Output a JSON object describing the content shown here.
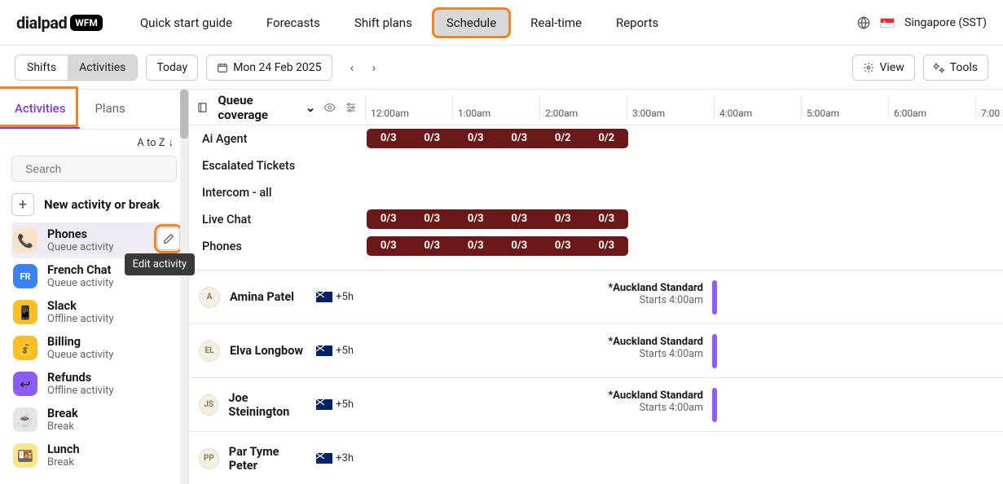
{
  "header": {
    "logo_text": "dialpad",
    "logo_badge": "WFM",
    "nav": [
      "Quick start guide",
      "Forecasts",
      "Shift plans",
      "Schedule",
      "Real-time",
      "Reports"
    ],
    "active_nav_index": 3,
    "region": "Singapore (SST)"
  },
  "subheader": {
    "toggle": [
      "Shifts",
      "Activities"
    ],
    "toggle_active_index": 1,
    "today": "Today",
    "date": "Mon 24 Feb 2025",
    "view": "View",
    "tools": "Tools"
  },
  "sidebar": {
    "tabs": [
      "Activities",
      "Plans"
    ],
    "active_tab_index": 0,
    "sort": "A to Z",
    "search_placeholder": "Search",
    "new_label": "New activity or break",
    "tooltip": "Edit activity",
    "items": [
      {
        "name": "Phones",
        "sub": "Queue activity",
        "icon": "phones",
        "glyph": "📞",
        "selected": true,
        "editable": true
      },
      {
        "name": "French Chat",
        "sub": "Queue activity",
        "icon": "french",
        "glyph": "FR"
      },
      {
        "name": "Slack",
        "sub": "Offline activity",
        "icon": "slack",
        "glyph": "📱"
      },
      {
        "name": "Billing",
        "sub": "Queue activity",
        "icon": "billing",
        "glyph": "💰"
      },
      {
        "name": "Refunds",
        "sub": "Offline activity",
        "icon": "refunds",
        "glyph": "↩"
      },
      {
        "name": "Break",
        "sub": "Break",
        "icon": "break",
        "glyph": "☕"
      },
      {
        "name": "Lunch",
        "sub": "Break",
        "icon": "lunch",
        "glyph": "🍱"
      }
    ]
  },
  "timeline": {
    "queue_label": "Queue coverage",
    "times": [
      "12:00am",
      "1:00am",
      "2:00am",
      "3:00am",
      "4:00am",
      "5:00am",
      "6:00am",
      "7:00"
    ],
    "queues": [
      {
        "name": "Ai Agent",
        "cov": [
          "0/3",
          "0/3",
          "0/3",
          "0/3",
          "0/2",
          "0/2"
        ]
      },
      {
        "name": "Escalated Tickets",
        "cov": []
      },
      {
        "name": "Intercom - all",
        "cov": []
      },
      {
        "name": "Live Chat",
        "cov": [
          "0/3",
          "0/3",
          "0/3",
          "0/3",
          "0/3",
          "0/3"
        ]
      },
      {
        "name": "Phones",
        "cov": [
          "0/3",
          "0/3",
          "0/3",
          "0/3",
          "0/3",
          "0/3"
        ]
      }
    ],
    "agents": [
      {
        "initials": "A",
        "name": "Amina Patel",
        "offset": "+5h",
        "tz": "*Auckland Standard",
        "start": "Starts 4:00am"
      },
      {
        "initials": "EL",
        "name": "Elva Longbow",
        "offset": "+5h",
        "tz": "*Auckland Standard",
        "start": "Starts 4:00am"
      },
      {
        "initials": "JS",
        "name": "Joe Steinington",
        "offset": "+5h",
        "tz": "*Auckland Standard",
        "start": "Starts 4:00am"
      },
      {
        "initials": "PP",
        "name": "Par Tyme Peter",
        "offset": "+3h",
        "tz": "",
        "start": ""
      }
    ]
  }
}
